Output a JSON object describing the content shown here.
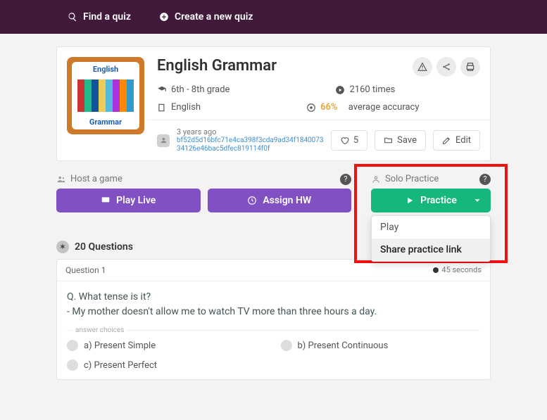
{
  "topbar": {
    "find": "Find a quiz",
    "create": "Create a new quiz"
  },
  "quiz": {
    "thumbTop": "English",
    "thumbBottom": "Grammar",
    "title": "English Grammar",
    "grade": "6th - 8th grade",
    "plays": "2160 times",
    "subject": "English",
    "accuracy_pct": "66%",
    "accuracy_txt": "average accuracy"
  },
  "author": {
    "age": "3 years ago",
    "hash": "bf52d5d16bfc71e4ca398f3cda9ad34f184007334126e46bac5dfec819114f0f"
  },
  "actions": {
    "likes": "5",
    "save": "Save",
    "edit": "Edit"
  },
  "host": {
    "label": "Host a game",
    "live": "Play Live",
    "assign": "Assign HW"
  },
  "solo": {
    "label": "Solo Practice",
    "btn": "Practice",
    "menu": [
      "Play",
      "Share practice link"
    ]
  },
  "questions": {
    "count": "20 Questions",
    "q1": {
      "header": "Question 1",
      "time": "45 seconds",
      "stem1": "Q. What tense is it?",
      "stem2": "- My mother doesn't allow me to watch TV more than three hours a day.",
      "ans_label": "answer choices",
      "choices": [
        "a) Present Simple",
        "b) Present Continuous",
        "c) Present Perfect"
      ]
    }
  }
}
